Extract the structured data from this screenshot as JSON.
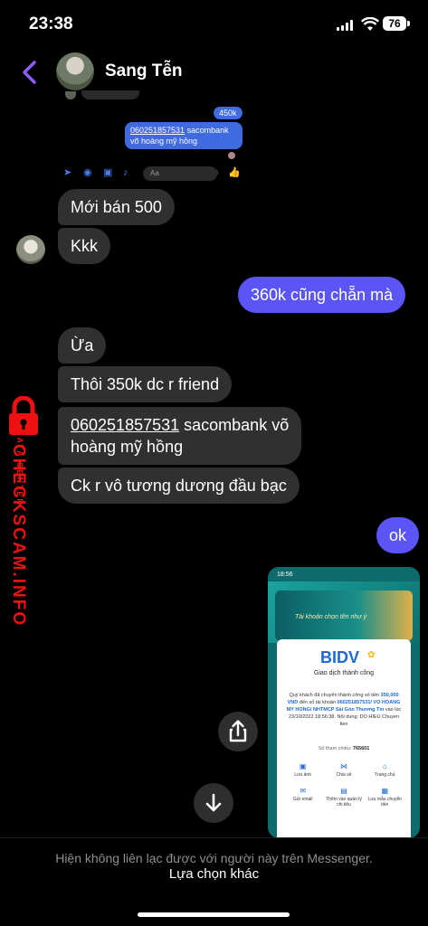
{
  "status_bar": {
    "time": "23:38",
    "battery": "76"
  },
  "header": {
    "contact_name": "Sang Tễn"
  },
  "embedded_chat": {
    "amount_bubble": "450k",
    "account_number": "060251857531",
    "account_rest": " sacombank võ hoàng mỹ hồng",
    "input_placeholder": "Aa"
  },
  "messages": {
    "m1": "Mới bán 500",
    "m2": "Kkk",
    "m3": "360k cũng chẵn mà",
    "m4": "Ừa",
    "m5": "Thôi 350k dc r friend",
    "m6_link": "060251857531",
    "m6_rest": " sacombank võ",
    "m6_line2": "hoàng mỹ hồng",
    "m7": "Ck r vô tương dương đầu bạc",
    "m8": "ok"
  },
  "watermark": {
    "title": "CHECKSCAM.INFO",
    "subtitle": "DATA CENTER"
  },
  "receipt": {
    "status_time": "18:56",
    "banner_text": "Tài khoản chọn tên như ý",
    "bank_logo": "BIDV",
    "subtitle": "Giao dịch thành công",
    "body_1": "Quý khách đã chuyển thành công số tiền",
    "amount": "350,000 VND",
    "body_2": "đến số tài khoản",
    "account": "060251857531/ VO HOANG MY HONG/ NHTMCP Sài Gòn Thương Tín",
    "body_3": "vào lúc 23/10/2022 18:56:38. Nội dung: DO HIEU Chuyen tien",
    "ref_label": "Số tham chiếu:",
    "ref_number": "765601",
    "actions": [
      "Lưu ảnh",
      "Chia sẻ",
      "Trang chủ",
      "Gửi email",
      "Thêm vào quản lý chi tiêu",
      "Lưu mẫu chuyển tiền"
    ]
  },
  "footer": {
    "notice": "Hiện không liên lạc được với người này trên Messenger.",
    "other_option": "Lựa chọn khác"
  }
}
